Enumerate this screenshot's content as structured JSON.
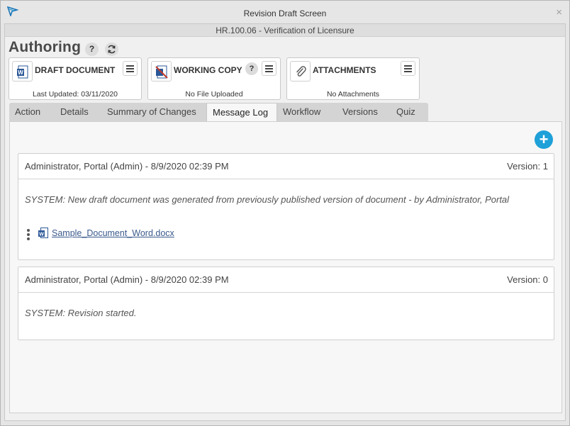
{
  "window": {
    "title": "Revision Draft Screen",
    "close_glyph": "×",
    "subtitle": "HR.100.06 - Verification of Licensure"
  },
  "page": {
    "heading": "Authoring",
    "help_glyph": "?"
  },
  "cards": [
    {
      "label": "DRAFT DOCUMENT",
      "status": "Last Updated: 03/11/2020",
      "icon": "word-doc-icon"
    },
    {
      "label": "WORKING COPY",
      "status": "No File Uploaded",
      "icon": "no-file-icon",
      "help_glyph": "?"
    },
    {
      "label": "ATTACHMENTS",
      "status": "No Attachments",
      "icon": "paperclip-icon"
    }
  ],
  "tabs": [
    {
      "label": "Action"
    },
    {
      "label": "Details"
    },
    {
      "label": "Summary of Changes"
    },
    {
      "label": "Message Log",
      "active": true
    },
    {
      "label": "Workflow"
    },
    {
      "label": "Versions"
    },
    {
      "label": "Quiz"
    }
  ],
  "add_button": {
    "glyph": "+"
  },
  "log_entries": [
    {
      "author": "Administrator, Portal (Admin)  -  8/9/2020 02:39 PM",
      "version": "Version: 1",
      "message": "SYSTEM: New draft document was generated from previously published version of document - by Administrator, Portal",
      "attachment": "Sample_Document_Word.docx"
    },
    {
      "author": "Administrator, Portal (Admin)  -  8/9/2020 02:39 PM",
      "version": "Version: 0",
      "message": "SYSTEM: Revision started."
    }
  ],
  "colors": {
    "accent": "#1ea0d8",
    "link": "#3a5a8c",
    "word_blue": "#2b5797",
    "no_file_red": "#c0392b"
  }
}
